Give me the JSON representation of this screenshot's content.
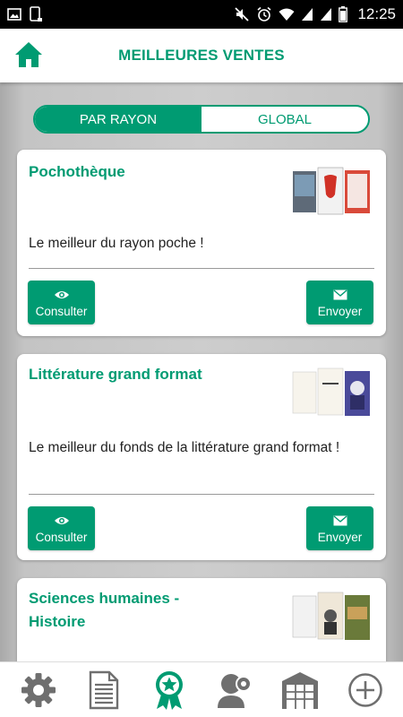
{
  "status_bar": {
    "time": "12:25"
  },
  "header": {
    "title": "MEILLEURES VENTES"
  },
  "tabs": [
    {
      "label": "PAR RAYON",
      "active": true
    },
    {
      "label": "GLOBAL",
      "active": false
    }
  ],
  "cards": [
    {
      "title": "Pochothèque",
      "description": "Le meilleur du rayon poche !",
      "consult_label": "Consulter",
      "send_label": "Envoyer"
    },
    {
      "title": "Littérature grand format",
      "description": "Le meilleur du fonds de la littérature grand format !",
      "consult_label": "Consulter",
      "send_label": "Envoyer"
    },
    {
      "title": "Sciences humaines - Histoire"
    }
  ],
  "bottom_nav": [
    "gear-icon",
    "document-icon",
    "award-star-icon",
    "user-gear-icon",
    "bookstore-icon",
    "plus-icon"
  ],
  "colors": {
    "accent": "#009b72",
    "background": "#c9c9c9"
  }
}
